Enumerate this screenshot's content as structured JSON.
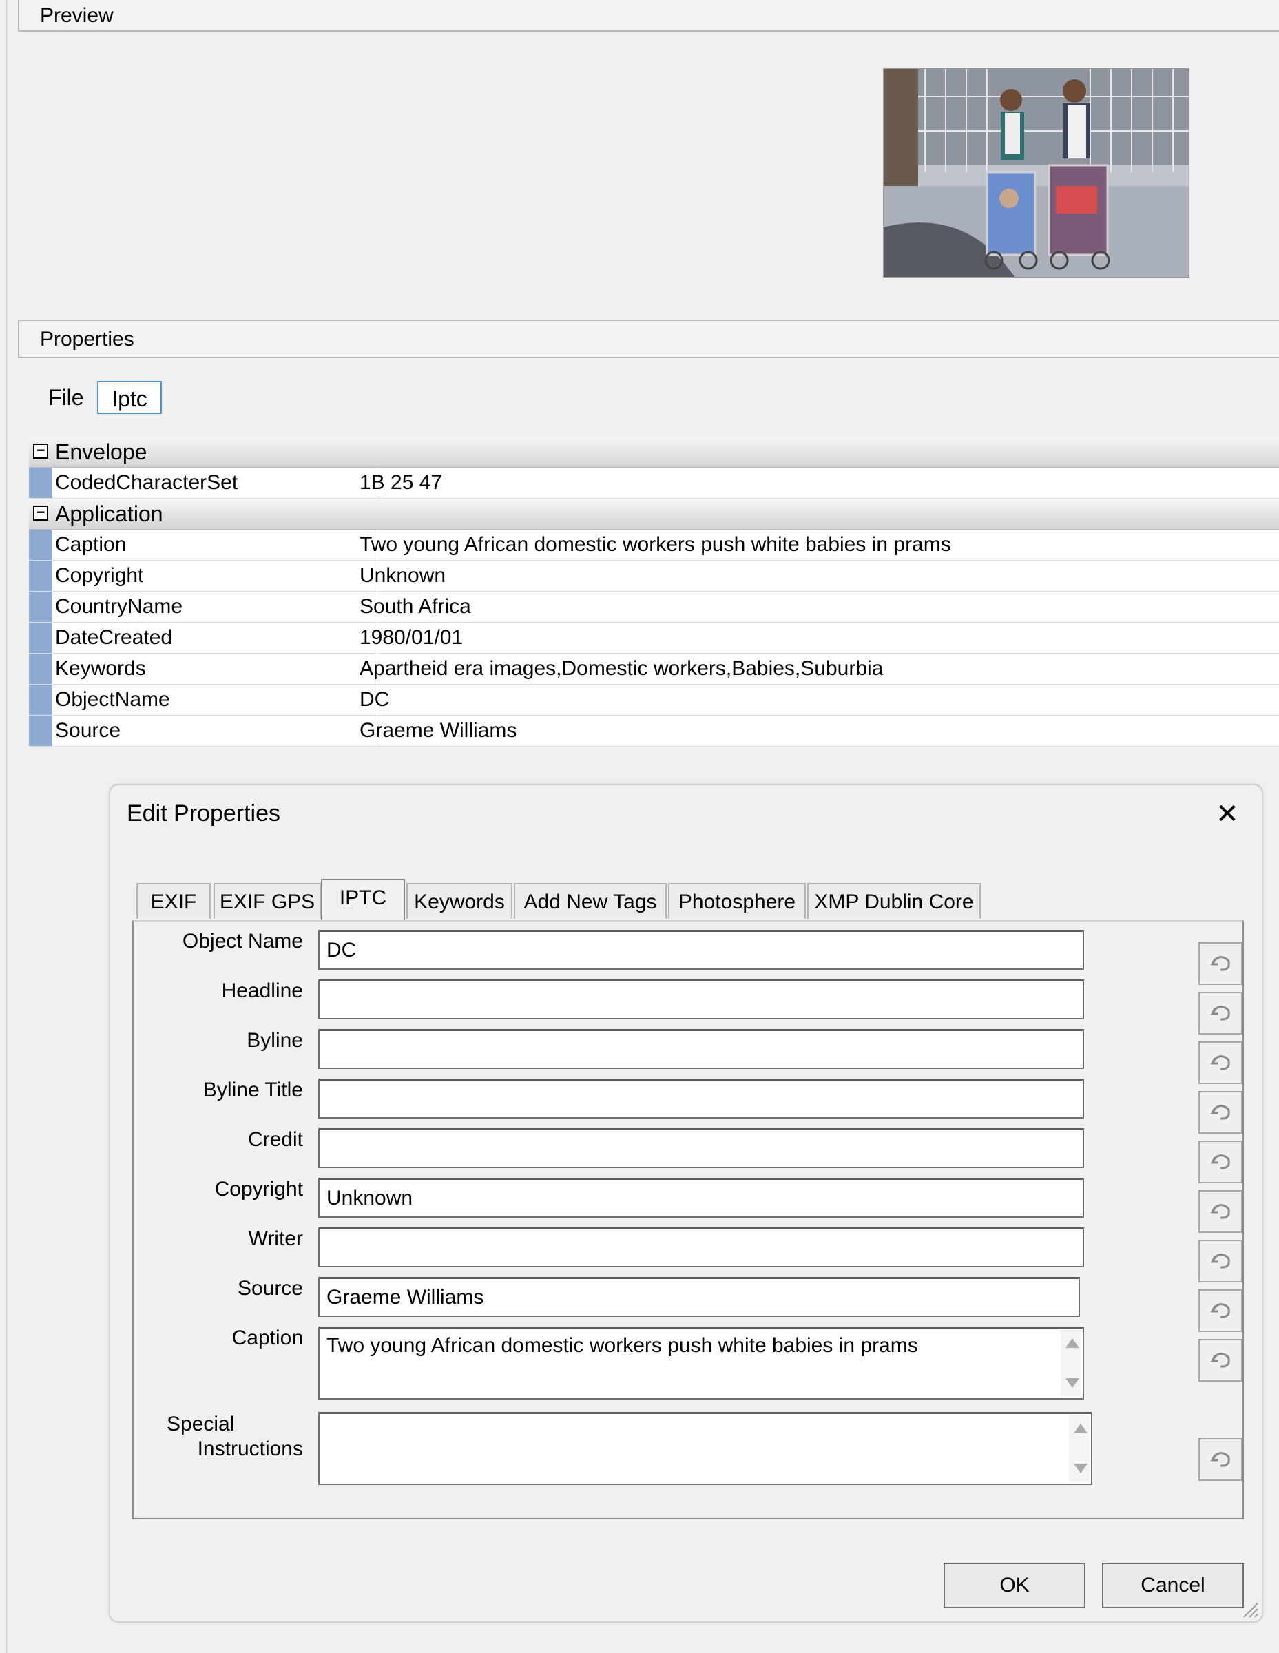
{
  "preview": {
    "header": "Preview"
  },
  "properties": {
    "header": "Properties",
    "tabs": [
      {
        "label": "File"
      },
      {
        "label": "Iptc",
        "active": true
      }
    ],
    "grid": [
      {
        "category": "Envelope",
        "toggle": "−",
        "rows": [
          {
            "name": "CodedCharacterSet",
            "value": "1B 25 47"
          }
        ]
      },
      {
        "category": "Application",
        "toggle": "−",
        "rows": [
          {
            "name": "Caption",
            "value": "Two young African domestic workers push white babies in prams"
          },
          {
            "name": "Copyright",
            "value": "Unknown"
          },
          {
            "name": "CountryName",
            "value": "South Africa"
          },
          {
            "name": "DateCreated",
            "value": "1980/01/01"
          },
          {
            "name": "Keywords",
            "value": "Apartheid era images,Domestic workers,Babies,Suburbia"
          },
          {
            "name": "ObjectName",
            "value": "DC"
          },
          {
            "name": "Source",
            "value": "Graeme Williams"
          }
        ]
      }
    ]
  },
  "dialog": {
    "title": "Edit Properties",
    "close": "✕",
    "tabs": [
      {
        "label": "EXIF"
      },
      {
        "label": "EXIF GPS"
      },
      {
        "label": "IPTC",
        "active": true
      },
      {
        "label": "Keywords"
      },
      {
        "label": "Add New Tags"
      },
      {
        "label": "Photosphere"
      },
      {
        "label": "XMP Dublin Core"
      }
    ],
    "fields": {
      "object_name": {
        "label": "Object Name",
        "value": "DC"
      },
      "headline": {
        "label": "Headline",
        "value": ""
      },
      "byline": {
        "label": "Byline",
        "value": ""
      },
      "byline_title": {
        "label": "Byline Title",
        "value": ""
      },
      "credit": {
        "label": "Credit",
        "value": ""
      },
      "copyright": {
        "label": "Copyright",
        "value": "Unknown"
      },
      "writer": {
        "label": "Writer",
        "value": ""
      },
      "source": {
        "label": "Source",
        "value": "Graeme Williams"
      },
      "caption": {
        "label": "Caption",
        "value": "Two young African domestic workers push white babies in prams"
      },
      "special_instructions": {
        "label_line1": "Special",
        "label_line2": "Instructions",
        "value": ""
      }
    },
    "buttons": {
      "ok": "OK",
      "cancel": "Cancel"
    }
  },
  "colors": {
    "grid_gutter": "#8eaad3",
    "tab_active_border": "#4b8fd6"
  }
}
